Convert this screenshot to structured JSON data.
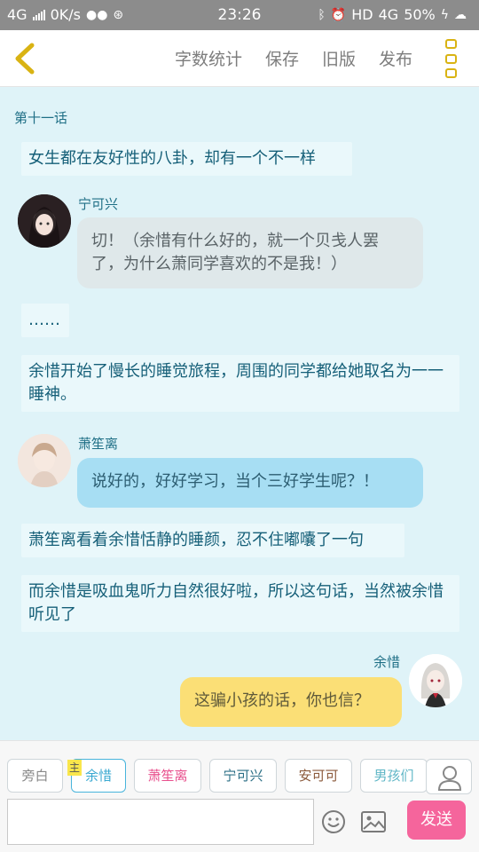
{
  "status_bar": {
    "network": "4G",
    "speed": "0K/s",
    "time": "23:26",
    "hd": "HD",
    "network2": "4G",
    "battery": "50%"
  },
  "toolbar": {
    "actions": [
      "字数统计",
      "保存",
      "旧版",
      "发布"
    ],
    "accent_color": "#d9b313"
  },
  "chat": {
    "chapter_title": "第十一话",
    "narration_1": "女生都在友好性的八卦，却有一个不一样",
    "msg1": {
      "name": "宁可兴",
      "text": "切！（余惜有什么好的，就一个贝戋人罢了，为什么萧同学喜欢的不是我！）"
    },
    "narration_2": "……",
    "narration_3": "余惜开始了慢长的睡觉旅程，周围的同学都给她取名为一一睡神。",
    "msg2": {
      "name": "萧笙离",
      "text": "说好的，好好学习，当个三好学生呢？！"
    },
    "narration_4": "萧笙离看着余惜恬静的睡颜，忍不住嘟囔了一句",
    "narration_5": "而余惜是吸血鬼听力自然很好啦，所以这句话，当然被余惜听见了",
    "msg3": {
      "name": "余惜",
      "text": "这骗小孩的话，你也信？"
    }
  },
  "roles": {
    "main_tag": "主",
    "items": [
      "旁白",
      "余惜",
      "萧笙离",
      "宁可兴",
      "安可可",
      "男孩们"
    ],
    "colors": [
      "#888888",
      "#3aa9d1",
      "#e8508d",
      "#2c6f86",
      "#8b5a3c",
      "#5fb6c6"
    ]
  },
  "input": {
    "placeholder": "",
    "send_label": "发送",
    "send_color": "#f5659c"
  }
}
